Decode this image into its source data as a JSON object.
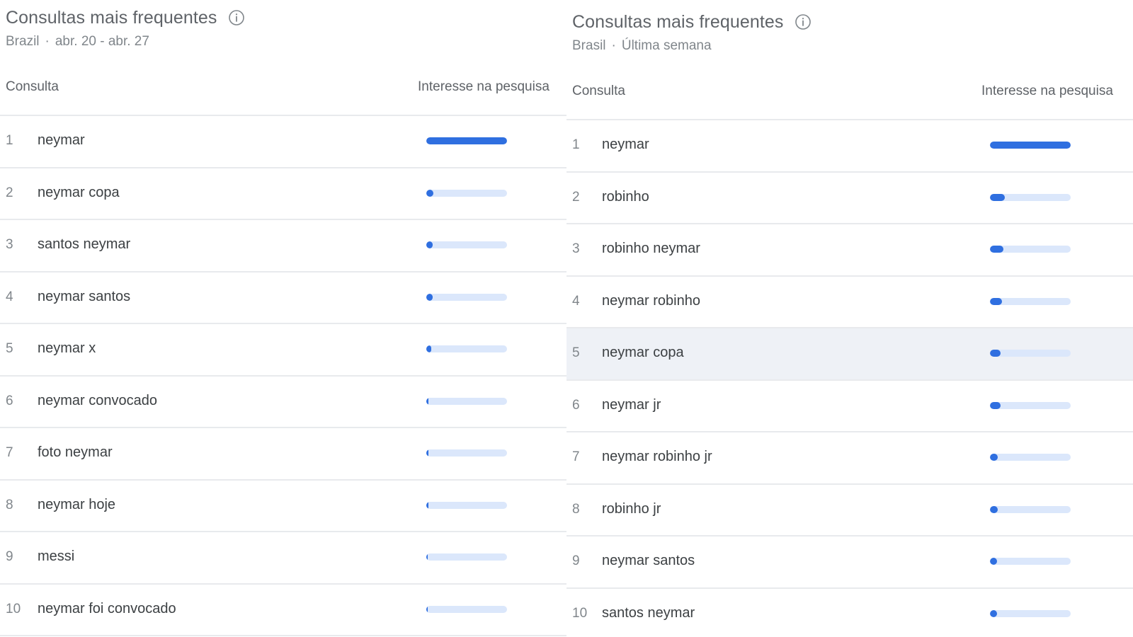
{
  "panels": [
    {
      "title": "Consultas mais frequentes",
      "region": "Brazil",
      "period": "abr. 20 - abr. 27",
      "column_query": "Consulta",
      "column_interest": "Interesse na pesquisa",
      "rows": [
        {
          "rank": "1",
          "query": "neymar",
          "interest": 100
        },
        {
          "rank": "2",
          "query": "neymar copa",
          "interest": 9
        },
        {
          "rank": "3",
          "query": "santos neymar",
          "interest": 8
        },
        {
          "rank": "4",
          "query": "neymar santos",
          "interest": 8
        },
        {
          "rank": "5",
          "query": "neymar x",
          "interest": 6
        },
        {
          "rank": "6",
          "query": "neymar convocado",
          "interest": 3
        },
        {
          "rank": "7",
          "query": "foto neymar",
          "interest": 3
        },
        {
          "rank": "8",
          "query": "neymar hoje",
          "interest": 3
        },
        {
          "rank": "9",
          "query": "messi",
          "interest": 2
        },
        {
          "rank": "10",
          "query": "neymar foi convocado",
          "interest": 2
        }
      ]
    },
    {
      "title": "Consultas mais frequentes",
      "region": "Brasil",
      "period": "Última semana",
      "column_query": "Consulta",
      "column_interest": "Interesse na pesquisa",
      "hovered_row": 5,
      "rows": [
        {
          "rank": "1",
          "query": "neymar",
          "interest": 100
        },
        {
          "rank": "2",
          "query": "robinho",
          "interest": 18
        },
        {
          "rank": "3",
          "query": "robinho neymar",
          "interest": 17
        },
        {
          "rank": "4",
          "query": "neymar robinho",
          "interest": 15
        },
        {
          "rank": "5",
          "query": "neymar copa",
          "interest": 13
        },
        {
          "rank": "6",
          "query": "neymar jr",
          "interest": 13
        },
        {
          "rank": "7",
          "query": "neymar robinho jr",
          "interest": 10
        },
        {
          "rank": "8",
          "query": "robinho jr",
          "interest": 10
        },
        {
          "rank": "9",
          "query": "neymar santos",
          "interest": 9
        },
        {
          "rank": "10",
          "query": "santos neymar",
          "interest": 9
        }
      ]
    }
  ],
  "colors": {
    "bar_fill": "#2f6fe0",
    "bar_track": "#dbe7fb",
    "hover_row": "#eef1f6"
  },
  "icons": {
    "info": "info-circle-icon"
  }
}
